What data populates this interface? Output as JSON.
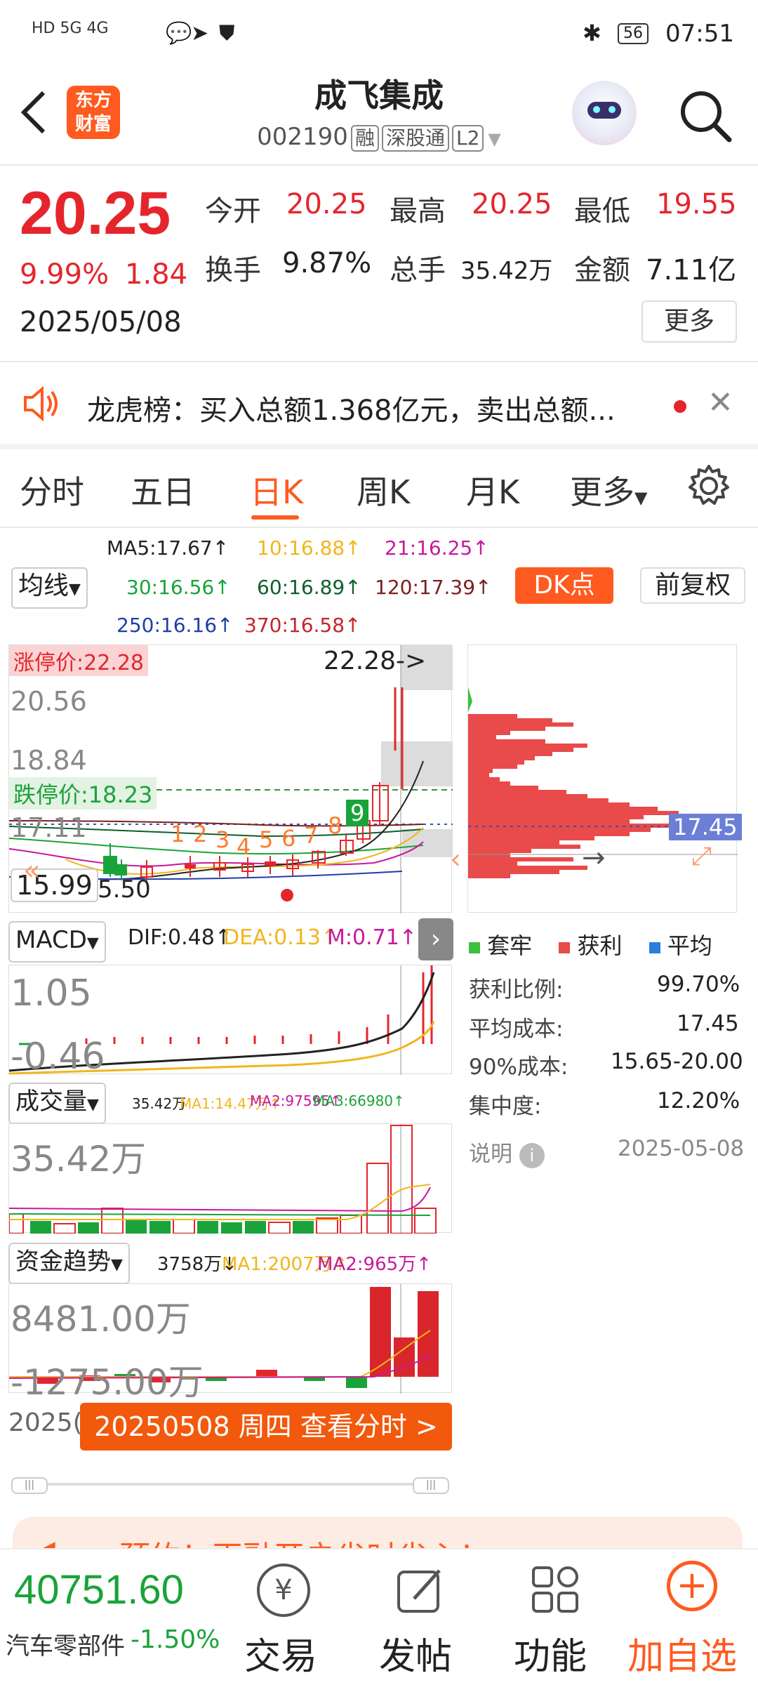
{
  "status": {
    "signal": "HD 5G 4G",
    "battery": "56",
    "time": "07:51"
  },
  "header": {
    "logo_text": "东方\n财富",
    "title": "成飞集成",
    "code": "002190",
    "tags": [
      "融",
      "深股通",
      "L2"
    ]
  },
  "quote": {
    "price": "20.25",
    "change_pct": "9.99%",
    "change": "1.84",
    "date": "2025/05/08",
    "open_label": "今开",
    "open": "20.25",
    "high_label": "最高",
    "high": "20.25",
    "low_label": "最低",
    "low": "19.55",
    "turnover_label": "换手",
    "turnover": "9.87%",
    "volume_label": "总手",
    "volume": "35.42万",
    "amount_label": "金额",
    "amount": "7.11亿",
    "more": "更多"
  },
  "notice": {
    "text": "龙虎榜：买入总额1.368亿元，卖出总额..."
  },
  "tabs": [
    {
      "label": "分时"
    },
    {
      "label": "五日"
    },
    {
      "label": "日K"
    },
    {
      "label": "周K"
    },
    {
      "label": "月K"
    },
    {
      "label": "更多"
    }
  ],
  "ma": {
    "selector": "均线",
    "ma5": "MA5:17.67↑",
    "ma10": "10:16.88↑",
    "ma21": "21:16.25↑",
    "ma30": "30:16.56↑",
    "ma60": "60:16.89↑",
    "ma120": "120:17.39↑",
    "ma250": "250:16.16↑",
    "ma370": "370:16.58↑",
    "dk": "DK点",
    "adjust": "前复权"
  },
  "kline": {
    "limit_up_label": "涨停价:22.28",
    "limit_up_tag": "22.28->",
    "limit_down_label": "跌停价:18.23",
    "y_labels": [
      "20.56",
      "18.84",
      "17.11",
      "15.99"
    ],
    "counters": [
      "1",
      "2",
      "3",
      "4",
      "5",
      "6",
      "7",
      "8",
      "9"
    ],
    "low_mark": "5.50"
  },
  "chip": {
    "avg_tag": "17.45",
    "legend": [
      "套牢",
      "获利",
      "平均"
    ],
    "rows": [
      {
        "label": "获利比例:",
        "value": "99.70%"
      },
      {
        "label": "平均成本:",
        "value": "17.45"
      },
      {
        "label": "90%成本:",
        "value": "15.65-20.00"
      },
      {
        "label": "集中度:",
        "value": "12.20%"
      }
    ],
    "note_label": "说明",
    "note_date": "2025-05-08"
  },
  "macd": {
    "selector": "MACD",
    "dif": "DIF:0.48↑",
    "dea": "DEA:0.13↑",
    "m": "M:0.71↑",
    "y_top": "1.05",
    "y_bottom": "-0.46"
  },
  "volume": {
    "selector": "成交量",
    "v": "35.42万",
    "ma1": "MA1:14.47万↑",
    "ma2": "MA2:97595↑",
    "ma3": "MA3:66980↑",
    "y_top": "35.42万"
  },
  "fund": {
    "selector": "资金趋势",
    "v": "3758万↓",
    "ma1": "MA1:2007万↑",
    "ma2": "MA2:965万↑",
    "y_top": "8481.00万",
    "y_bottom": "-1275.00万"
  },
  "footer_chart": {
    "date_prefix": "2025(",
    "banner": "20250508 周四 查看分时 >"
  },
  "ad": {
    "text": "...预约！再融开户省时省心！"
  },
  "bottom": {
    "index_value": "40751.60",
    "index_name": "汽车零部件",
    "index_change": "-1.50%",
    "items": [
      "交易",
      "发帖",
      "功能",
      "加自选"
    ]
  },
  "colors": {
    "up": "#e4262c",
    "down": "#1aa33a",
    "accent": "#ff5a1f",
    "ma_yellow": "#f2b51c",
    "ma_purple": "#c7199c"
  }
}
